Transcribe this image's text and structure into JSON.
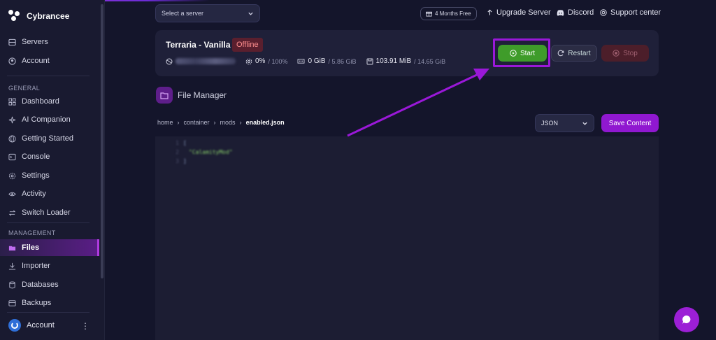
{
  "brand": {
    "name": "Cybrancee"
  },
  "sidebar": {
    "top_items": [
      {
        "label": "Servers",
        "icon": "servers-icon"
      },
      {
        "label": "Account",
        "icon": "account-icon"
      }
    ],
    "general_heading": "GENERAL",
    "general_items": [
      {
        "label": "Dashboard",
        "icon": "dashboard-icon"
      },
      {
        "label": "AI Companion",
        "icon": "sparkle-icon"
      },
      {
        "label": "Getting Started",
        "icon": "globe-icon"
      },
      {
        "label": "Console",
        "icon": "terminal-icon"
      },
      {
        "label": "Settings",
        "icon": "gear-icon"
      },
      {
        "label": "Activity",
        "icon": "eye-icon"
      },
      {
        "label": "Switch Loader",
        "icon": "switch-icon"
      }
    ],
    "management_heading": "MANAGEMENT",
    "management_items": [
      {
        "label": "Files",
        "icon": "folder-icon",
        "active": true
      },
      {
        "label": "Importer",
        "icon": "download-icon"
      },
      {
        "label": "Databases",
        "icon": "database-icon"
      },
      {
        "label": "Backups",
        "icon": "backup-icon"
      }
    ],
    "footer": {
      "label": "Account"
    }
  },
  "topbar": {
    "server_select_placeholder": "Select a server",
    "promo": "4 Months Free",
    "links": {
      "upgrade": "Upgrade Server",
      "discord": "Discord",
      "support": "Support center"
    }
  },
  "server": {
    "title": "Terraria - Vanilla",
    "status": "Offline",
    "cpu": "0%",
    "cpu_limit": "/ 100%",
    "memory": "0 GiB",
    "memory_limit": "/ 5.86 GiB",
    "disk": "103.91 MiB",
    "disk_limit": "/ 14.65 GiB",
    "buttons": {
      "start": "Start",
      "restart": "Restart",
      "stop": "Stop"
    }
  },
  "file_manager": {
    "title": "File Manager",
    "breadcrumb": [
      "home",
      "container",
      "mods",
      "enabled.json"
    ],
    "language": "JSON",
    "save_label": "Save Content",
    "code_lines": [
      {
        "n": "1",
        "text": "[",
        "kind": "punct"
      },
      {
        "n": "2",
        "text": "\"CalamityMod\"",
        "kind": "str"
      },
      {
        "n": "3",
        "text": "]",
        "kind": "punct"
      }
    ]
  },
  "colors": {
    "accent": "#9018d0",
    "start_green": "#3f9c2a",
    "offline_red": "#ff8f8f",
    "background": "#14152b"
  }
}
